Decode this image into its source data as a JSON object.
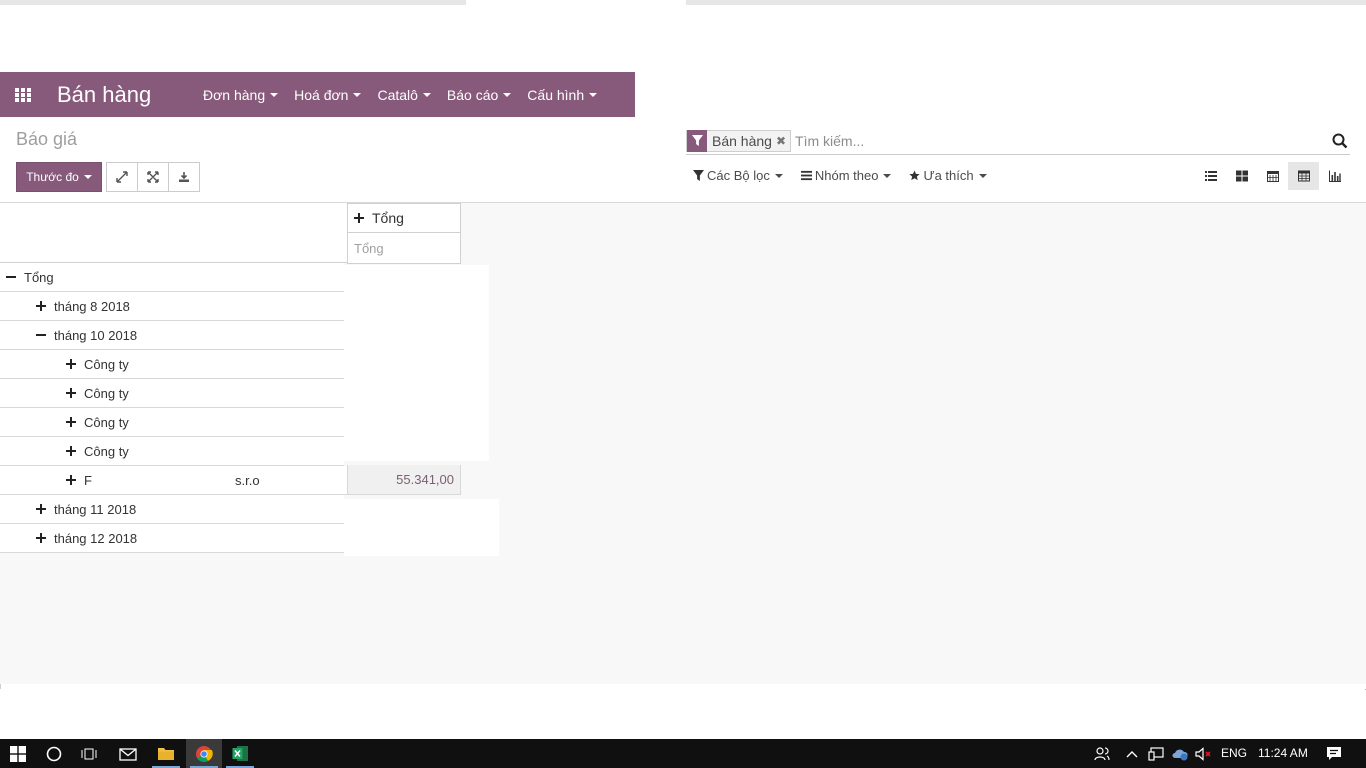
{
  "navbar": {
    "app_title": "Bán hàng",
    "menu": [
      {
        "label": "Đơn hàng"
      },
      {
        "label": "Hoá đơn"
      },
      {
        "label": "Catalô"
      },
      {
        "label": "Báo cáo"
      },
      {
        "label": "Cấu hình"
      }
    ]
  },
  "control_panel": {
    "breadcrumb": "Báo giá",
    "measures_label": "Thước đo",
    "search": {
      "facet_label": "Bán hàng",
      "facet_remove": "✖",
      "placeholder": "Tìm kiếm..."
    },
    "filters_label": "Các Bộ lọc",
    "group_by_label": "Nhóm theo",
    "favorites_label": "Ưa thích"
  },
  "pivot": {
    "col_header": "Tổng",
    "measure_header": "Tổng",
    "rows": [
      {
        "label": "Tổng"
      },
      {
        "label": "tháng 8 2018"
      },
      {
        "label": "tháng 10 2018"
      },
      {
        "label": "Công ty"
      },
      {
        "label": "Công ty"
      },
      {
        "label": "Công ty"
      },
      {
        "label": "Công ty"
      },
      {
        "label": "F",
        "label_tail": "s.r.o",
        "value": "55.341,00"
      },
      {
        "label": "tháng 11 2018"
      },
      {
        "label": "tháng 12 2018"
      }
    ]
  },
  "taskbar": {
    "language": "ENG",
    "time": "11:24 AM"
  },
  "colors": {
    "brand": "#875a7b",
    "value_text": "#7c5f74"
  }
}
